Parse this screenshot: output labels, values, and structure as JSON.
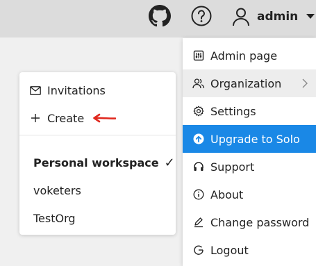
{
  "header": {
    "username": "admin",
    "icons": [
      "github-icon",
      "help-icon",
      "user-icon",
      "caret-down-icon"
    ]
  },
  "org_menu": {
    "invitations": "Invitations",
    "create": "Create",
    "workspaces": [
      "Personal workspace",
      "voketers",
      "TestOrg"
    ],
    "checked": "✓"
  },
  "user_menu": {
    "items": [
      {
        "label": "Admin page",
        "icon": "admin-icon"
      },
      {
        "label": "Organization",
        "icon": "organization-icon"
      },
      {
        "label": "Settings",
        "icon": "gear-icon"
      },
      {
        "label": "Upgrade to Solo",
        "icon": "upgrade-icon"
      },
      {
        "label": "Support",
        "icon": "headset-icon"
      },
      {
        "label": "About",
        "icon": "info-icon"
      },
      {
        "label": "Change password",
        "icon": "pencil-icon"
      },
      {
        "label": "Logout",
        "icon": "logout-icon"
      }
    ]
  },
  "colors": {
    "accent": "#1a88e6",
    "annotation_arrow": "#e0281e",
    "topbar": "#dcdcdc"
  }
}
